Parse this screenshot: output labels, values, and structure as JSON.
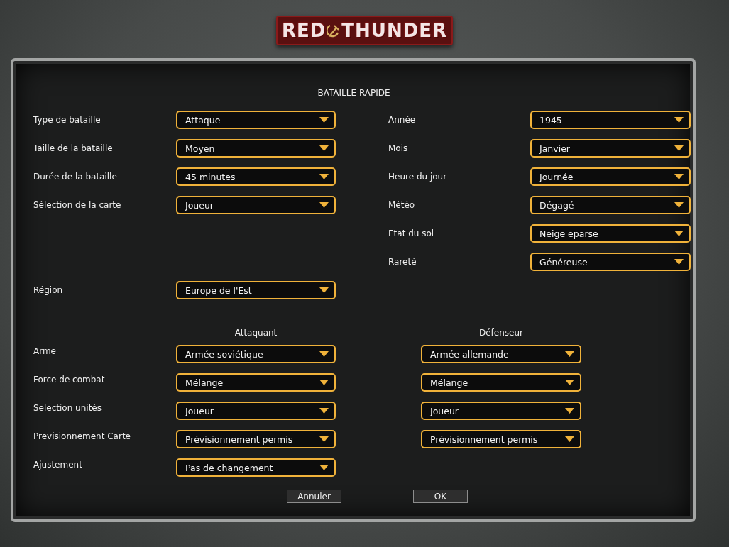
{
  "logo": {
    "left": "RED",
    "right": "THUNDER"
  },
  "title": "BATAILLE RAPIDE",
  "rows": [
    {
      "left": {
        "label": "Type de bataille",
        "value": "Attaque"
      },
      "right": {
        "label": "Année",
        "value": "1945"
      }
    },
    {
      "left": {
        "label": "Taille de la bataille",
        "value": "Moyen"
      },
      "right": {
        "label": "Mois",
        "value": "Janvier"
      }
    },
    {
      "left": {
        "label": "Durée de la bataille",
        "value": "45 minutes"
      },
      "right": {
        "label": "Heure du jour",
        "value": "Journée"
      }
    },
    {
      "left": {
        "label": "Sélection de la carte",
        "value": "Joueur"
      },
      "right": {
        "label": "Météo",
        "value": "Dégagé"
      }
    },
    {
      "right": {
        "label": "Etat du sol",
        "value": "Neige eparse"
      }
    },
    {
      "right": {
        "label": "Rareté",
        "value": "Généreuse"
      }
    },
    {
      "left": {
        "label": "Région",
        "value": "Europe de l'Est"
      }
    }
  ],
  "sides": {
    "attacker_heading": "Attaquant",
    "defender_heading": "Défenseur",
    "rows": [
      {
        "label": "Arme",
        "attacker": "Armée soviétique",
        "defender": "Armée allemande"
      },
      {
        "label": "Force de combat",
        "attacker": "Mélange",
        "defender": "Mélange"
      },
      {
        "label": "Selection unités",
        "attacker": "Joueur",
        "defender": "Joueur"
      },
      {
        "label": "Previsionnement Carte",
        "attacker": "Prévisionnement permis",
        "defender": "Prévisionnement permis"
      },
      {
        "label": "Ajustement",
        "attacker": "Pas de changement"
      }
    ]
  },
  "buttons": [
    "Annuler",
    "OK"
  ]
}
